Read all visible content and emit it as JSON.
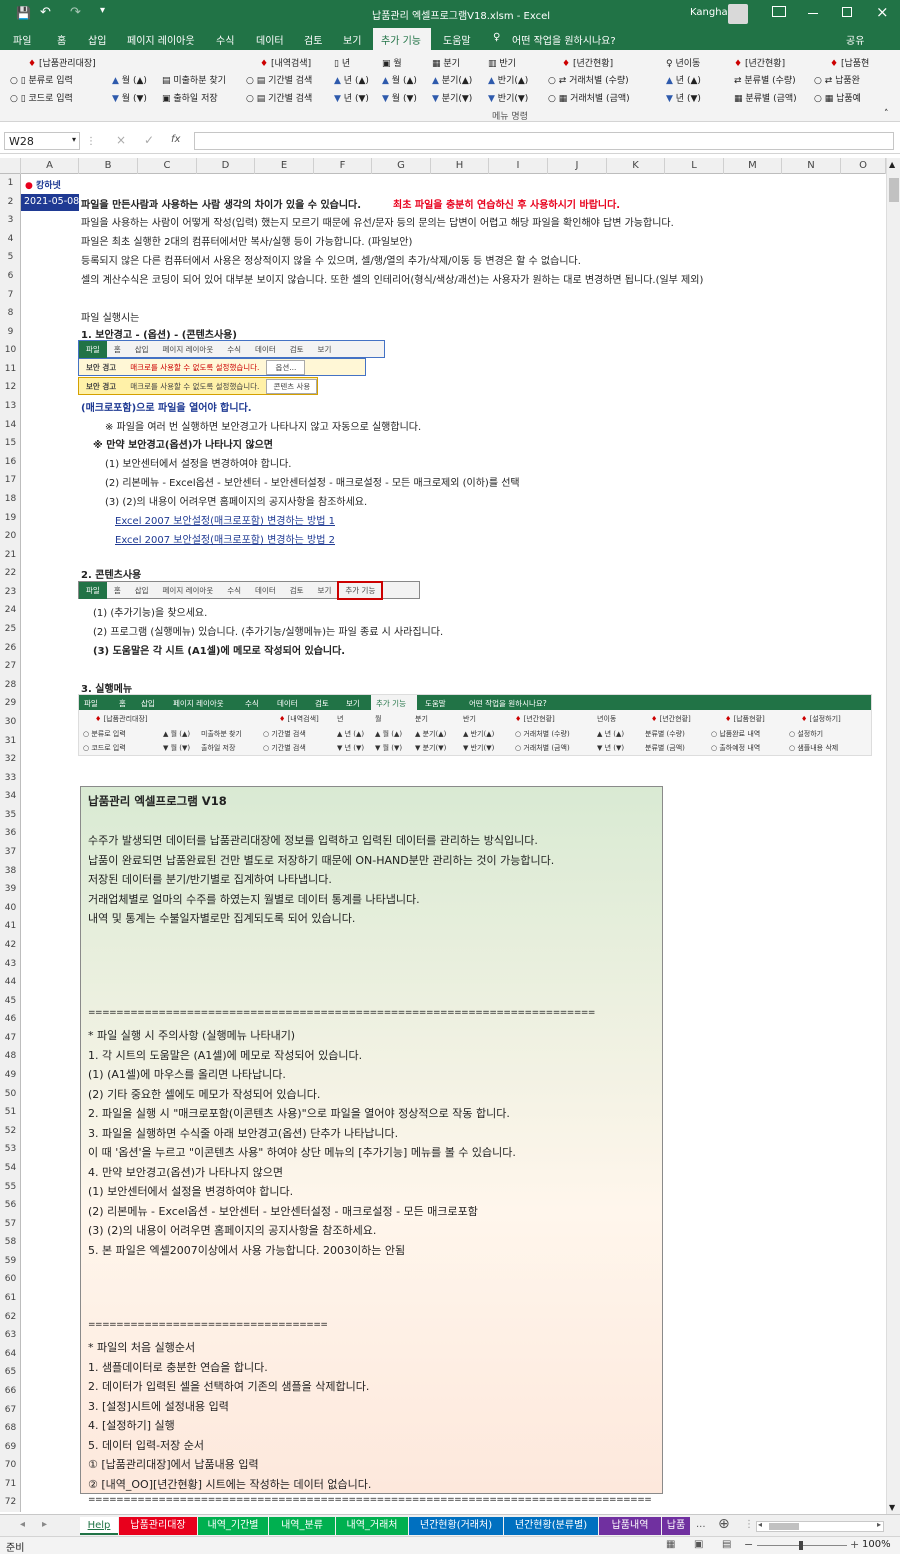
{
  "titlebar": {
    "title": "납품관리 엑셀프로그램V18.xlsm  -  Excel",
    "user": "Kangha",
    "qat_save": "💾",
    "qat_undo": "↶",
    "qat_redo": "↷"
  },
  "tabs": [
    "파일",
    "홈",
    "삽입",
    "페이지 레이아웃",
    "수식",
    "데이터",
    "검토",
    "보기",
    "추가 기능",
    "도움말"
  ],
  "tell_me": "어떤 작업을 원하시나요?",
  "share": "공유",
  "ribbon": {
    "groups": [
      "[납품관리대장]",
      "[내역검색]",
      "년",
      "월",
      "분기",
      "반기",
      "[년간현황]",
      "년이동",
      "[년간현황]",
      "[납품현"
    ],
    "row1": [
      "분류로 입력",
      "월 (▲)",
      "미출하분 찾기",
      "기간별 검색",
      "년 (▲)",
      "월 (▲)",
      "분기(▲)",
      "반기(▲)",
      "거래처별 (수량)",
      "년 (▲)",
      "분류별 (수량)",
      "납품완"
    ],
    "row2": [
      "코드로 입력",
      "월 (▼)",
      "출하일 저장",
      "기간별 검색",
      "년 (▼)",
      "월 (▼)",
      "분기(▼)",
      "반기(▼)",
      "거래처별 (금액)",
      "년 (▼)",
      "분류별 (금액)",
      "납품예"
    ],
    "footer": "메뉴 명령"
  },
  "formula": {
    "namebox": "W28",
    "fx": "fx"
  },
  "columns": [
    "A",
    "B",
    "C",
    "D",
    "E",
    "F",
    "G",
    "H",
    "I",
    "J",
    "K",
    "L",
    "M",
    "N",
    "O"
  ],
  "rows": [
    "1",
    "2",
    "3",
    "4",
    "5",
    "6",
    "7",
    "8",
    "9",
    "10",
    "11",
    "12",
    "13",
    "14",
    "15",
    "16",
    "17",
    "18",
    "19",
    "20",
    "21",
    "22",
    "23",
    "24",
    "25",
    "26",
    "27",
    "28",
    "29",
    "30",
    "31",
    "32",
    "33",
    "34",
    "35",
    "36",
    "37",
    "38",
    "39",
    "40",
    "41",
    "42",
    "43",
    "44",
    "45",
    "46",
    "47",
    "48",
    "49",
    "50",
    "51",
    "52",
    "53",
    "54",
    "55",
    "56",
    "57",
    "58",
    "59",
    "60",
    "61",
    "62",
    "63",
    "64",
    "65",
    "66",
    "67",
    "68",
    "69",
    "70",
    "71",
    "72"
  ],
  "sheet": {
    "logo": "캉하넷",
    "date": "2021-05-08",
    "r2a": "파일을 만든사람과 사용하는 사람 생각의 차이가 있을 수 있습니다.",
    "r2b": "최초 파일을 충분히 연습하신 후 사용하시기 바랍니다.",
    "r3": "파일을 사용하는 사람이 어떻게 작성(입력) 했는지 모르기 때문에 유선/문자 등의 문의는 답변이 어렵고 해당 파일을 확인해야 답변 가능합니다.",
    "r4": "파일은 최초 실행한 2대의 컴퓨터에서만 복사/실행 등이 가능합니다.  (파일보안)",
    "r5": "등록되지 않은 다른 컴퓨터에서 사용은 정상적이지 않을 수 있으며, 셀/행/열의 추가/삭제/이동 등 변경은 할 수 없습니다.",
    "r6": "셀의 계산수식은 코딩이 되어 있어 대부분 보이지 않습니다. 또한 셀의 인테리어(형식/색상/괘선)는 사용자가 원하는 대로 변경하면 됩니다.(일부 제외)",
    "r8": "파일 실행시는",
    "r9": "1. 보안경고 - (옵션) - (콘텐츠사용)",
    "mini1": [
      "파일",
      "홈",
      "삽입",
      "페이지 레이아웃",
      "수식",
      "데이터",
      "검토",
      "보기"
    ],
    "mini2": [
      "보안 경고",
      "매크로를 사용할 수 없도록 설정했습니다.",
      "옵션..."
    ],
    "mini3": [
      "보안 경고",
      "매크로를 사용할 수 없도록 설정했습니다.",
      "콘텐츠 사용"
    ],
    "r13": "(매크로포함)으로 파일을 열어야 합니다.",
    "r14": "※ 파일을 여러 번 실행하면 보안경고가 나타나지 않고 자동으로 실행합니다.",
    "r15": "※ 만약 보안경고(옵션)가 나타나지 않으면",
    "r16": "(1) 보안센터에서 설정을 변경하여야 합니다.",
    "r17": "(2) 리본메뉴 - Excel옵션 - 보안센터 - 보안센터설정 - 매크로설정 - 모든 매크로제외 (이하)를 선택",
    "r18": "(3) (2)의 내용이 어려우면 홈페이지의 공지사항을 참조하세요.",
    "r19": "Excel 2007 보안설정(매크로포함) 변경하는 방법 1",
    "r20": "Excel 2007 보안설정(매크로포함) 변경하는 방법 2",
    "r22": "2. 콘텐츠사용",
    "mini4": [
      "파일",
      "홈",
      "삽입",
      "페이지 레이아웃",
      "수식",
      "데이터",
      "검토",
      "보기",
      "추가 기능"
    ],
    "r24": "(1) (추가기능)을 찾으세요.",
    "r25": "(2) 프로그램 (실행메뉴) 있습니다. (추가기능/실행메뉴)는 파일 종료 시 사라집니다.",
    "r26": "(3) 도움말은 각 시트 (A1셀)에 메모로 작성되어 있습니다.",
    "r28": "3. 실행메뉴",
    "mini5tabs": [
      "파일",
      "홈",
      "삽입",
      "페이지 레이아웃",
      "수식",
      "데이터",
      "검토",
      "보기",
      "추가 기능",
      "도움말",
      "어떤 작업을 원하시나요?"
    ],
    "mini5r1": [
      "[납품관리대장]",
      "[내역검색]",
      "년",
      "월",
      "분기",
      "반기",
      "[년간현황]",
      "년이동",
      "[년간현황]",
      "[납품현황]",
      "[설정하기]"
    ],
    "mini5r2": [
      "분류로 입력",
      "월 (▲)",
      "미출하분 찾기",
      "기간별 검색",
      "년 (▲)",
      "월 (▲)",
      "분기(▲)",
      "반기(▲)",
      "거래처별 (수량)",
      "년 (▲)",
      "분류별 (수량)",
      "납품완료 내역",
      "설정하기"
    ],
    "mini5r3": [
      "코드로 입력",
      "월 (▼)",
      "출하일 저장",
      "기간별 검색",
      "년 (▼)",
      "월 (▼)",
      "분기(▼)",
      "반기(▼)",
      "거래처별 (금액)",
      "년 (▼)",
      "분류별 (금액)",
      "출하예정 내역",
      "샘플내용 삭제"
    ]
  },
  "note": [
    "납품관리 엑셀프로그램 V18",
    "",
    "수주가 발생되면 데이터를 납품관리대장에 정보를 입력하고 입력된 데이터를 관리하는 방식입니다.",
    "납품이 완료되면 납품완료된 건만 별도로 저장하기 때문에 ON-HAND분만 관리하는 것이 가능합니다.",
    "저장된 데이터를 분기/반기별로 집계하여 나타냅니다.",
    "거래업체별로 얼마의 수주를 하였는지 월별로 데이터 통계를 나타냅니다.",
    "내역 및 통계는 수불일자별로만 집계되도록 되어 있습니다.",
    "",
    "",
    "",
    "",
    "========================================================================",
    "* 파일 실행 시 주의사항 (실행메뉴 나타내기)",
    "1. 각 시트의 도움말은 (A1셀)에 메모로 작성되어 있습니다.",
    "    (1) (A1셀)에 마우스를 올리면 나타납니다.",
    "    (2) 기타 중요한 셀에도 메모가 작성되어 있습니다.",
    "2. 파일을 실행 시 \"매크로포함(이콘텐츠 사용)\"으로 파일을 열어야 정상적으로 작동 합니다.",
    "3. 파일을 실행하면 수식줄 아래 보안경고(옵션) 단추가 나타납니다.",
    "     이 때 '옵션'을 누르고 \"이콘텐츠 사용\" 하여야 상단 메뉴의 [추가기능] 메뉴를 볼 수 있습니다.",
    "4. 만약 보안경고(옵션)가 나타나지 않으면",
    "    (1) 보안센터에서 설정을 변경하여야 합니다.",
    "    (2) 리본메뉴 - Excel옵션 - 보안센터 - 보안센터설정 - 매크로설정 - 모든 매크로포함",
    "    (3) (2)의 내용이 어려우면 홈페이지의 공지사항을 참조하세요.",
    "5. 본 파일은 엑셀2007이상에서 사용 가능합니다. 2003이하는 안됨",
    "",
    "",
    "",
    "==================================",
    "* 파일의 처음 실행순서",
    "1. 샘플데이터로 충분한 연습을 합니다.",
    "2. 데이터가 입력된 셀을 선택하여 기존의 샘플을 삭제합니다.",
    "3. [설정]시트에 설정내용 입력",
    "4. [설정하기] 실행",
    "5. 데이터 입력-저장 순서",
    "    ① [납품관리대장]에서 납품내용 입력",
    "    ② [내역_OO][년간현황] 시트에는 작성하는 데이터 없습니다.",
    "================================================================================"
  ],
  "sheettabs": [
    {
      "label": "Help",
      "color": "#ffffff",
      "fg": "#217346"
    },
    {
      "label": "납품관리대장",
      "color": "#e8001c",
      "fg": "#ffffff"
    },
    {
      "label": "내역_기간별",
      "color": "#00b050",
      "fg": "#ffffff"
    },
    {
      "label": "내역_분류",
      "color": "#00b050",
      "fg": "#ffffff"
    },
    {
      "label": "내역_거래처",
      "color": "#00b050",
      "fg": "#ffffff"
    },
    {
      "label": "년간현황(거래처)",
      "color": "#0070c0",
      "fg": "#ffffff"
    },
    {
      "label": "년간현황(분류별)",
      "color": "#0070c0",
      "fg": "#ffffff"
    },
    {
      "label": "납품내역",
      "color": "#7030a0",
      "fg": "#ffffff"
    },
    {
      "label": "납품",
      "color": "#7030a0",
      "fg": "#ffffff"
    }
  ],
  "status": {
    "ready": "준비",
    "zoom": "100%"
  }
}
